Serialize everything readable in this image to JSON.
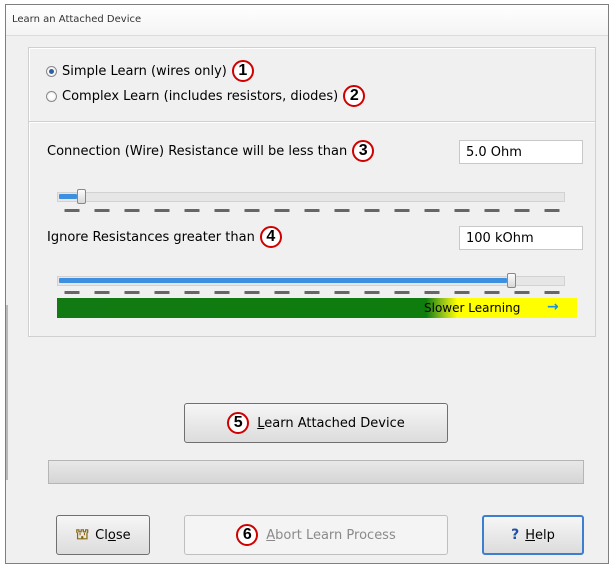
{
  "window": {
    "title": "Learn an Attached Device"
  },
  "learn_mode": {
    "options": [
      {
        "label": "Simple Learn (wires only)",
        "selected": true,
        "callout": "1"
      },
      {
        "label": "Complex Learn (includes resistors, diodes)",
        "selected": false,
        "callout": "2"
      }
    ]
  },
  "wire_resistance": {
    "label": "Connection (Wire) Resistance will be less than",
    "callout": "3",
    "value": "5.0 Ohm",
    "slider_level": 0.04
  },
  "ignore_resistance": {
    "label": "Ignore Resistances greater than",
    "callout": "4",
    "value": "100 kOhm",
    "slider_level": 0.9
  },
  "speed_bar": {
    "text": "Slower Learning",
    "arrow": "→"
  },
  "learn_button": {
    "callout": "5",
    "label_prefix": "",
    "label_underline": "L",
    "label_rest": "earn Attached Device"
  },
  "progress": {
    "level": 0
  },
  "buttons": {
    "close": {
      "prefix": "Cl",
      "underline": "o",
      "rest": "se"
    },
    "abort": {
      "callout": "6",
      "underline": "A",
      "rest": "bort Learn Process"
    },
    "help": {
      "icon": "?",
      "underline": "H",
      "rest": "elp"
    }
  },
  "colors": {
    "fast_green": "#0e7d0e",
    "slow_yellow": "#ffff00",
    "slider_blue": "#3d8fe0",
    "callout_red": "#d00000",
    "help_border": "#3c7fd0"
  },
  "icons": [
    "radio-selected-icon",
    "radio-unselected-icon",
    "door-exit-icon",
    "question-icon",
    "right-arrow-icon"
  ]
}
